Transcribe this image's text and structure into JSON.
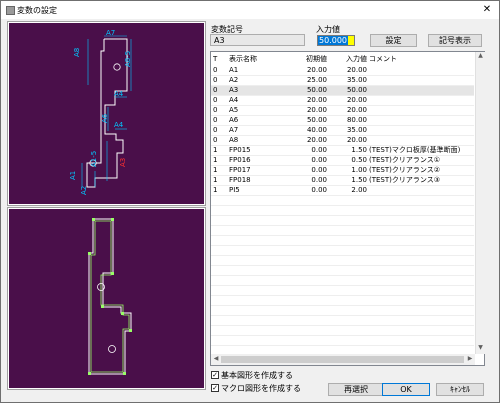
{
  "window": {
    "title": "変数の設定",
    "close_glyph": "✕"
  },
  "variable": {
    "symbol_label": "変数記号",
    "symbol_value": "A3",
    "input_label": "入力値",
    "input_value": "50.000"
  },
  "buttons": {
    "set": "設定",
    "show_symbols": "記号表示",
    "reselect": "再選択",
    "ok": "OK",
    "cancel": "ｷｬﾝｾﾙ"
  },
  "table": {
    "headers": [
      "T",
      "表示名称",
      "初期値",
      "入力値",
      "コメント"
    ],
    "selected_row": 2,
    "rows": [
      [
        "0",
        "A1",
        "20.00",
        "20.00",
        ""
      ],
      [
        "0",
        "A2",
        "25.00",
        "35.00",
        ""
      ],
      [
        "0",
        "A3",
        "50.00",
        "50.00",
        ""
      ],
      [
        "0",
        "A4",
        "20.00",
        "20.00",
        ""
      ],
      [
        "0",
        "A5",
        "20.00",
        "20.00",
        ""
      ],
      [
        "0",
        "A6",
        "50.00",
        "80.00",
        ""
      ],
      [
        "0",
        "A7",
        "40.00",
        "35.00",
        ""
      ],
      [
        "0",
        "A8",
        "20.00",
        "20.00",
        ""
      ],
      [
        "1",
        "FP015",
        "0.00",
        "1.50",
        "(TEST)マクロ板厚(基準断面)"
      ],
      [
        "1",
        "FP016",
        "0.00",
        "0.50",
        "(TEST)クリアランス①"
      ],
      [
        "1",
        "FP017",
        "0.00",
        "1.00",
        "(TEST)クリアランス②"
      ],
      [
        "1",
        "FP018",
        "0.00",
        "1.50",
        "(TEST)クリアランス③"
      ],
      [
        "1",
        "PI5",
        "0.00",
        "2.00",
        ""
      ]
    ]
  },
  "preview": {
    "dimension_labels": [
      "A7",
      "A8",
      "A8-5",
      "A4",
      "A6",
      "A4",
      "A1",
      "A2",
      "A1-5",
      "A3"
    ]
  },
  "options": {
    "basic_shape_label": "基本図形を作成する",
    "basic_shape_checked": true,
    "macro_shape_label": "マクロ図形を作成する",
    "macro_shape_checked": true
  },
  "colors": {
    "canvas_bg": "#4a0f4a",
    "dimension_text": "#00c8ff",
    "highlight_text": "#ff3030",
    "outline_white": "#ffffff",
    "outline_green": "#99ff66",
    "input_highlight": "#ffff00"
  }
}
